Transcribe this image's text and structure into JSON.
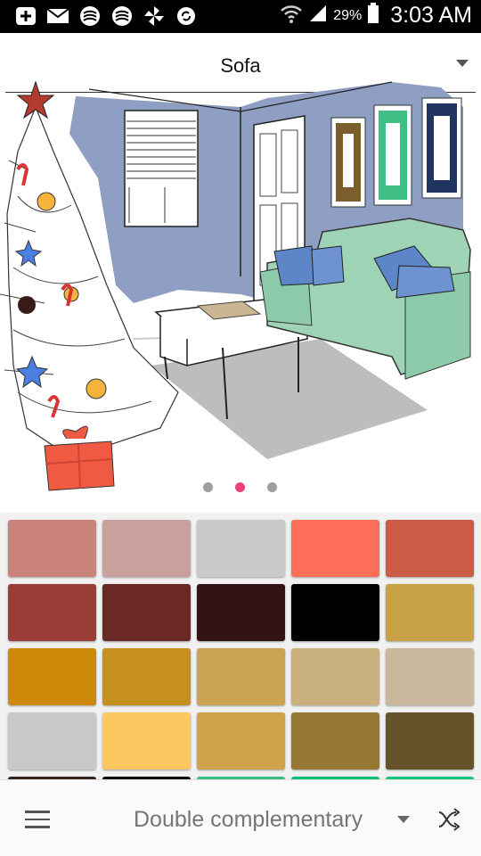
{
  "status_bar": {
    "battery_percent": "29%",
    "time": "3:03 AM",
    "icons": [
      "plus-icon",
      "mail-icon",
      "bank-icon",
      "bank-icon",
      "pinwheel-icon",
      "recycle-icon",
      "wifi-icon",
      "signal-icon",
      "battery-icon"
    ]
  },
  "header": {
    "selected_item": "Sofa"
  },
  "pager": {
    "pages": 3,
    "active_page": 2
  },
  "palette": {
    "swatches": [
      "#c9837b",
      "#c8a19c",
      "#c9c9c9",
      "#fd6e59",
      "#cb5a47",
      "#9a3d37",
      "#6b2926",
      "#321513",
      "#010101",
      "#c8a046",
      "#cd8909",
      "#c68f1e",
      "#cba352",
      "#c9b07c",
      "#c9b89d",
      "#c8c8c8",
      "#fdc85f",
      "#cfa34a",
      "#977833",
      "#67532b",
      "#32231b",
      "#060606",
      "#3bbd84",
      "#07c273",
      "#17c77f"
    ]
  },
  "bottom_bar": {
    "scheme_label": "Double complementary"
  }
}
